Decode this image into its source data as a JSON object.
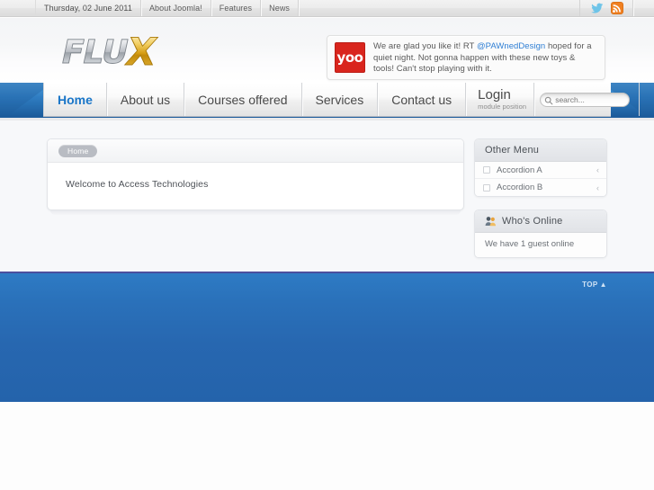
{
  "topbar": {
    "date": "Thursday, 02 June 2011",
    "links": [
      "About Joomla!",
      "Features",
      "News"
    ],
    "social": [
      {
        "name": "twitter-icon",
        "color": "#6ec4e8"
      },
      {
        "name": "rss-icon",
        "color": "#f08022"
      }
    ]
  },
  "header": {
    "logo_text_primary": "FLU",
    "logo_text_accent": "X",
    "logo_colors": {
      "primary": "#b8bcc2",
      "accent": "#d9a01c"
    },
    "tweet": {
      "avatar_label": "yoo",
      "avatar_color": "#d9251d",
      "text_before": "We are glad you like it! RT ",
      "mention": "@PAWnedDesign",
      "text_after": " hoped for a quiet night. Not gonna happen with these new toys & tools! Can't stop playing with it.",
      "mention_color": "#2f7fd4"
    }
  },
  "nav": {
    "items": [
      {
        "label": "Home",
        "active": true
      },
      {
        "label": "About us",
        "active": false
      },
      {
        "label": "Courses offered",
        "active": false
      },
      {
        "label": "Services",
        "active": false
      },
      {
        "label": "Contact us",
        "active": false
      }
    ],
    "active_color": "#1a76c8",
    "login": {
      "title": "Login",
      "subtitle": "module position"
    },
    "search": {
      "placeholder": "search...",
      "value": ""
    }
  },
  "main": {
    "breadcrumb": "Home",
    "article_text": "Welcome to Access Technologies"
  },
  "sidebar": {
    "modules": [
      {
        "title": "Other Menu",
        "icon": "",
        "items": [
          {
            "label": "Accordion A",
            "chevron": "‹"
          },
          {
            "label": "Accordion B",
            "chevron": "‹"
          }
        ]
      },
      {
        "title": "Who's Online",
        "icon": "users-icon",
        "body": "We have 1 guest online"
      }
    ]
  },
  "footer": {
    "top_link": "TOP",
    "top_arrow": "▲",
    "background_color": "#2767b0",
    "divider_color": "#4a4f9e"
  }
}
